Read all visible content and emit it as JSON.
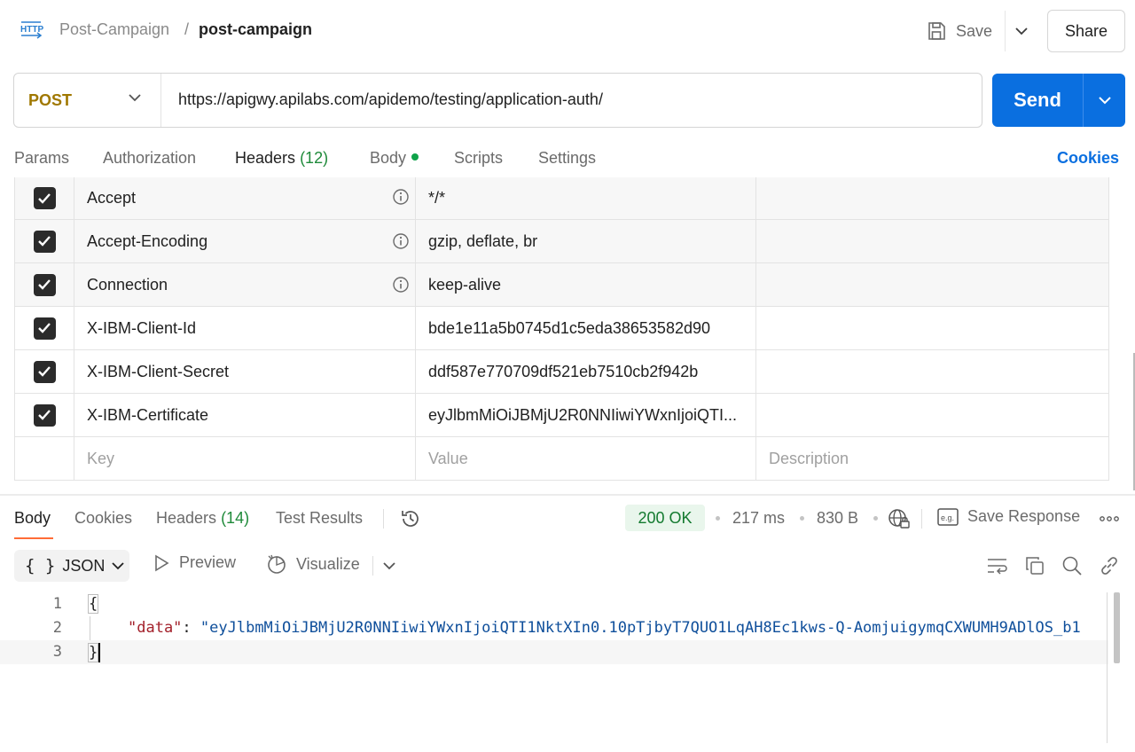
{
  "header": {
    "breadcrumb_parent": "Post-Campaign",
    "breadcrumb_sep": "/",
    "breadcrumb_current": "post-campaign",
    "save_label": "Save",
    "share_label": "Share",
    "http_icon": "http-icon"
  },
  "request": {
    "method": "POST",
    "method_color": "#a07800",
    "url": "https://apigwy.apilabs.com/apidemo/testing/application-auth/",
    "send_label": "Send",
    "send_color": "#0a6fe0"
  },
  "request_tabs": {
    "params": "Params",
    "authorization": "Authorization",
    "headers": "Headers",
    "headers_count": "(12)",
    "body": "Body",
    "scripts": "Scripts",
    "settings": "Settings",
    "cookies": "Cookies"
  },
  "headers_table": {
    "rows": [
      {
        "key": "Accept",
        "value": "*/*",
        "auto": true
      },
      {
        "key": "Accept-Encoding",
        "value": "gzip, deflate, br",
        "auto": true
      },
      {
        "key": "Connection",
        "value": "keep-alive",
        "auto": true
      },
      {
        "key": "X-IBM-Client-Id",
        "value": "bde1e11a5b0745d1c5eda38653582d90",
        "auto": false
      },
      {
        "key": "X-IBM-Client-Secret",
        "value": "ddf587e770709df521eb7510cb2f942b",
        "auto": false
      },
      {
        "key": "X-IBM-Certificate",
        "value": "eyJlbmMiOiJBMjU2R0NNIiwiYWxnIjoiQTI...",
        "auto": false
      }
    ],
    "placeholder_key": "Key",
    "placeholder_value": "Value",
    "placeholder_description": "Description"
  },
  "response": {
    "tabs": {
      "body": "Body",
      "cookies": "Cookies",
      "headers": "Headers",
      "headers_count": "(14)",
      "test_results": "Test Results"
    },
    "status": "200 OK",
    "time": "217 ms",
    "size": "830 B",
    "save_response": "Save Response",
    "format": "JSON",
    "preview": "Preview",
    "visualize": "Visualize",
    "lines": [
      "1",
      "2",
      "3"
    ],
    "open_brace": "{",
    "close_brace": "}",
    "json_key": "\"data\"",
    "json_colon": ": ",
    "json_value": "\"eyJlbmMiOiJBMjU2R0NNIiwiYWxnIjoiQTI1NktXIn0.10pTjbyT7QUO1LqAH8Ec1kws-Q-AomjuigymqCXWUMH9ADlOS_b1"
  }
}
